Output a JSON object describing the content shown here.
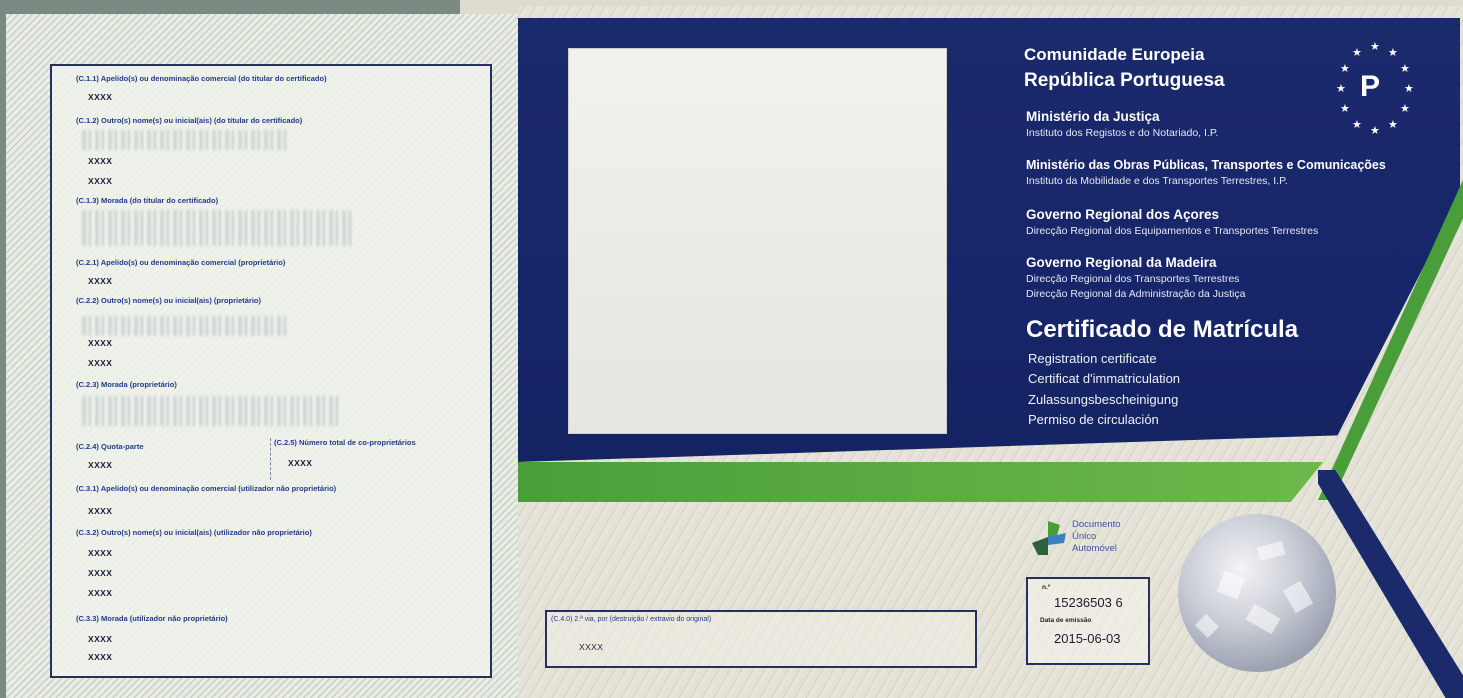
{
  "header": {
    "line1": "Comunidade Europeia",
    "line2": "República Portuguesa",
    "country_code": "P"
  },
  "ministries": [
    {
      "name": "Ministério da Justiça",
      "institutes": [
        "Instituto dos Registos e do Notariado, I.P."
      ]
    },
    {
      "name": "Ministério das Obras Públicas, Transportes e Comunicações",
      "institutes": [
        "Instituto da Mobilidade e dos Transportes Terrestres, I.P."
      ]
    },
    {
      "name": "Governo Regional dos Açores",
      "institutes": [
        "Direcção Regional dos Equipamentos e Transportes Terrestres"
      ]
    },
    {
      "name": "Governo Regional da Madeira",
      "institutes": [
        "Direcção Regional dos Transportes Terrestres",
        "Direcção Regional da Administração da Justiça"
      ]
    }
  ],
  "certificate": {
    "title": "Certificado de Matrícula",
    "translations": [
      "Registration certificate",
      "Certificat d'immatriculation",
      "Zulassungsbescheinigung",
      "Permiso de circulación"
    ]
  },
  "logo": {
    "line1": "Documento",
    "line2": "Único",
    "line3": "Automóvel"
  },
  "number_box": {
    "number_label": "n.º",
    "number": "15236503 6",
    "date_label": "Data de emissão",
    "date": "2015-06-03"
  },
  "duplicate": {
    "label": "(C.4.0) 2.ª via, por (destruição / extravio do original)",
    "value": "XXXX"
  },
  "left_fields": {
    "c11_label": "(C.1.1) Apelido(s) ou denominação comercial (do titular do certificado)",
    "c11_value": "XXXX",
    "c12_label": "(C.1.2) Outro(s) nome(s) ou inicial(ais) (do titular do certificado)",
    "c12_values": [
      "XXXX",
      "XXXX"
    ],
    "c13_label": "(C.1.3) Morada (do titular do certificado)",
    "c21_label": "(C.2.1) Apelido(s) ou denominação comercial (proprietário)",
    "c21_value": "XXXX",
    "c22_label": "(C.2.2) Outro(s) nome(s) ou inicial(ais) (proprietário)",
    "c22_values": [
      "XXXX",
      "XXXX"
    ],
    "c23_label": "(C.2.3) Morada (proprietário)",
    "c24_label": "(C.2.4) Quota-parte",
    "c24_value": "XXXX",
    "c25_label": "(C.2.5) Número total de co-proprietários",
    "c25_value": "XXXX",
    "c31_label": "(C.3.1) Apelido(s) ou denominação comercial (utilizador não proprietário)",
    "c31_value": "XXXX",
    "c32_label": "(C.3.2) Outro(s) nome(s) ou inicial(ais) (utilizador não proprietário)",
    "c32_values": [
      "XXXX",
      "XXXX",
      "XXXX"
    ],
    "c33_label": "(C.3.3) Morada (utilizador não proprietário)",
    "c33_values": [
      "XXXX",
      "XXXX"
    ]
  },
  "colors": {
    "navy": "#1b2a6b",
    "green": "#4a9e3a",
    "field_text": "#243a8a"
  }
}
